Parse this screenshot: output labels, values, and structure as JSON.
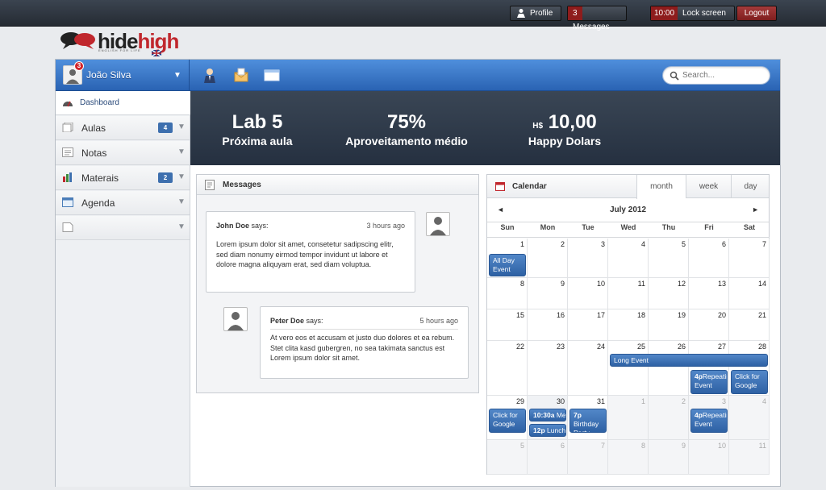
{
  "topbar": {
    "profile_label": "Profile",
    "messages_count": "3",
    "messages_label": "Messages",
    "lock_time": "10:00",
    "lock_label": "Lock screen",
    "logout_label": "Logout"
  },
  "logo": {
    "text_a": "hide",
    "text_b": "high",
    "tagline": "ENGLISH FOR LIFE"
  },
  "user": {
    "name": "João Silva",
    "badge": "3"
  },
  "search": {
    "placeholder": "Search..."
  },
  "sidebar": {
    "items": [
      {
        "label": "Dashboard",
        "badge": ""
      },
      {
        "label": "Aulas",
        "badge": "4"
      },
      {
        "label": "Notas",
        "badge": ""
      },
      {
        "label": "Materais",
        "badge": "2"
      },
      {
        "label": "Agenda",
        "badge": ""
      },
      {
        "label": "",
        "badge": ""
      }
    ]
  },
  "stats": {
    "next_class_value": "Lab 5",
    "next_class_label": "Próxima aula",
    "avg_value": "75%",
    "avg_label": "Aproveitamento médio",
    "dollars_currency": "H$",
    "dollars_value": "10,00",
    "dollars_label": "Happy Dolars"
  },
  "messages": {
    "title": "Messages",
    "items": [
      {
        "name": "John Doe",
        "says": "says:",
        "time": "3 hours ago",
        "body": "Lorem ipsum dolor sit amet, consetetur sadipscing elitr, sed diam nonumy eirmod tempor invidunt ut labore et dolore magna aliquyam erat, sed diam voluptua."
      },
      {
        "name": "Peter Doe",
        "says": "says:",
        "time": "5 hours ago",
        "body": "At vero eos et accusam et justo duo dolores et ea rebum. Stet clita kasd gubergren, no sea takimata sanctus est Lorem ipsum dolor sit amet."
      }
    ]
  },
  "calendar": {
    "title": "Calendar",
    "tabs": [
      "month",
      "week",
      "day"
    ],
    "active_tab": "month",
    "month_title": "July 2012",
    "prev": "◄",
    "next": "►",
    "weekdays": [
      "Sun",
      "Mon",
      "Tue",
      "Wed",
      "Thu",
      "Fri",
      "Sat"
    ],
    "weeks": [
      [
        "1",
        "2",
        "3",
        "4",
        "5",
        "6",
        "7"
      ],
      [
        "8",
        "9",
        "10",
        "11",
        "12",
        "13",
        "14"
      ],
      [
        "15",
        "16",
        "17",
        "18",
        "19",
        "20",
        "21"
      ],
      [
        "22",
        "23",
        "24",
        "25",
        "26",
        "27",
        "28"
      ],
      [
        "29",
        "30",
        "31",
        "1",
        "2",
        "3",
        "4"
      ],
      [
        "5",
        "6",
        "7",
        "8",
        "9",
        "10",
        "11"
      ]
    ],
    "events": {
      "all_day": "All Day Event",
      "long": "Long Event",
      "repeat_a_time": "4p",
      "repeat_a": "Repeating Event",
      "google_a": "Click for Google",
      "google_b": "Click for Google",
      "meeting_time": "10:30a",
      "meeting": "Meeting",
      "lunch_time": "12p",
      "lunch": "Lunch",
      "birthday_time": "7p",
      "birthday": "Birthday Party",
      "repeat_b_time": "4p",
      "repeat_b": "Repeating Event"
    }
  }
}
